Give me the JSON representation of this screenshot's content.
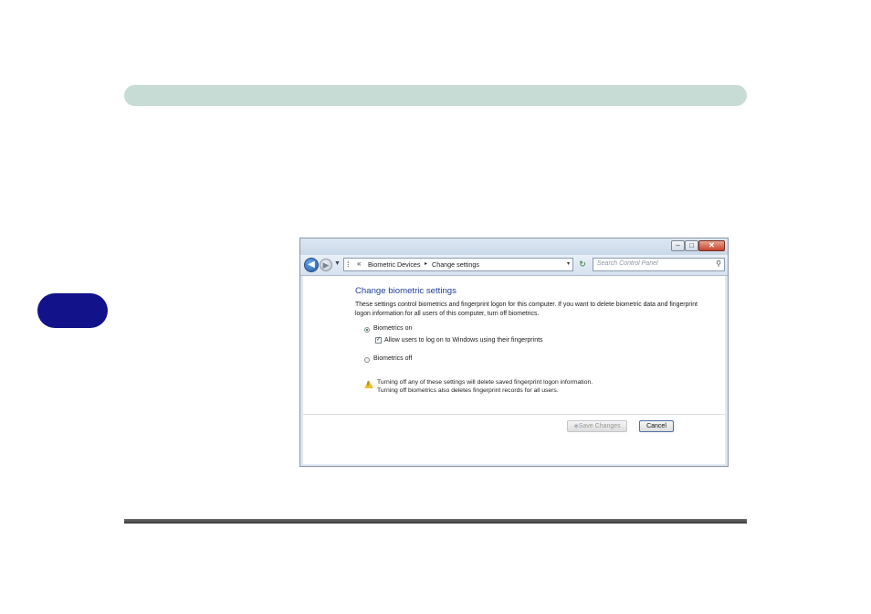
{
  "window": {
    "title_buttons": {
      "minimize": "–",
      "maximize": "□",
      "close": "✕"
    },
    "nav": {
      "back_glyph": "◀",
      "forward_glyph": "▶",
      "history_glyph": "▼",
      "address_icon": "⁞",
      "address_chevron": "«",
      "breadcrumb": [
        "Biometric Devices",
        "Change settings"
      ],
      "breadcrumb_separator": "▸",
      "address_dropdown": "▾",
      "refresh_glyph": "↻",
      "search_placeholder": "Search Control Panel",
      "search_glyph": "⚲"
    },
    "content": {
      "heading": "Change biometric settings",
      "description": "These settings control biometrics and fingerprint logon for this computer. If you want to delete biometric data and fingerprint logon information for all users of this computer, turn off biometrics.",
      "option_on": "Biometrics on",
      "allow_logon": "Allow users to log on to Windows using their fingerprints",
      "allow_logon_check": "✓",
      "option_off": "Biometrics off",
      "warning_line1": "Turning off any of these settings will delete saved fingerprint logon information.",
      "warning_line2": "Turning off biometrics also deletes fingerprint records for all users.",
      "warning_mark": "!",
      "save_button": "Save Changes",
      "save_shield": "◈",
      "cancel_button": "Cancel",
      "biometrics_enabled": true
    }
  },
  "colors": {
    "header_bar": "#c8dcd6",
    "chapter_tab": "#12128a",
    "heading_blue": "#1e3f97"
  }
}
